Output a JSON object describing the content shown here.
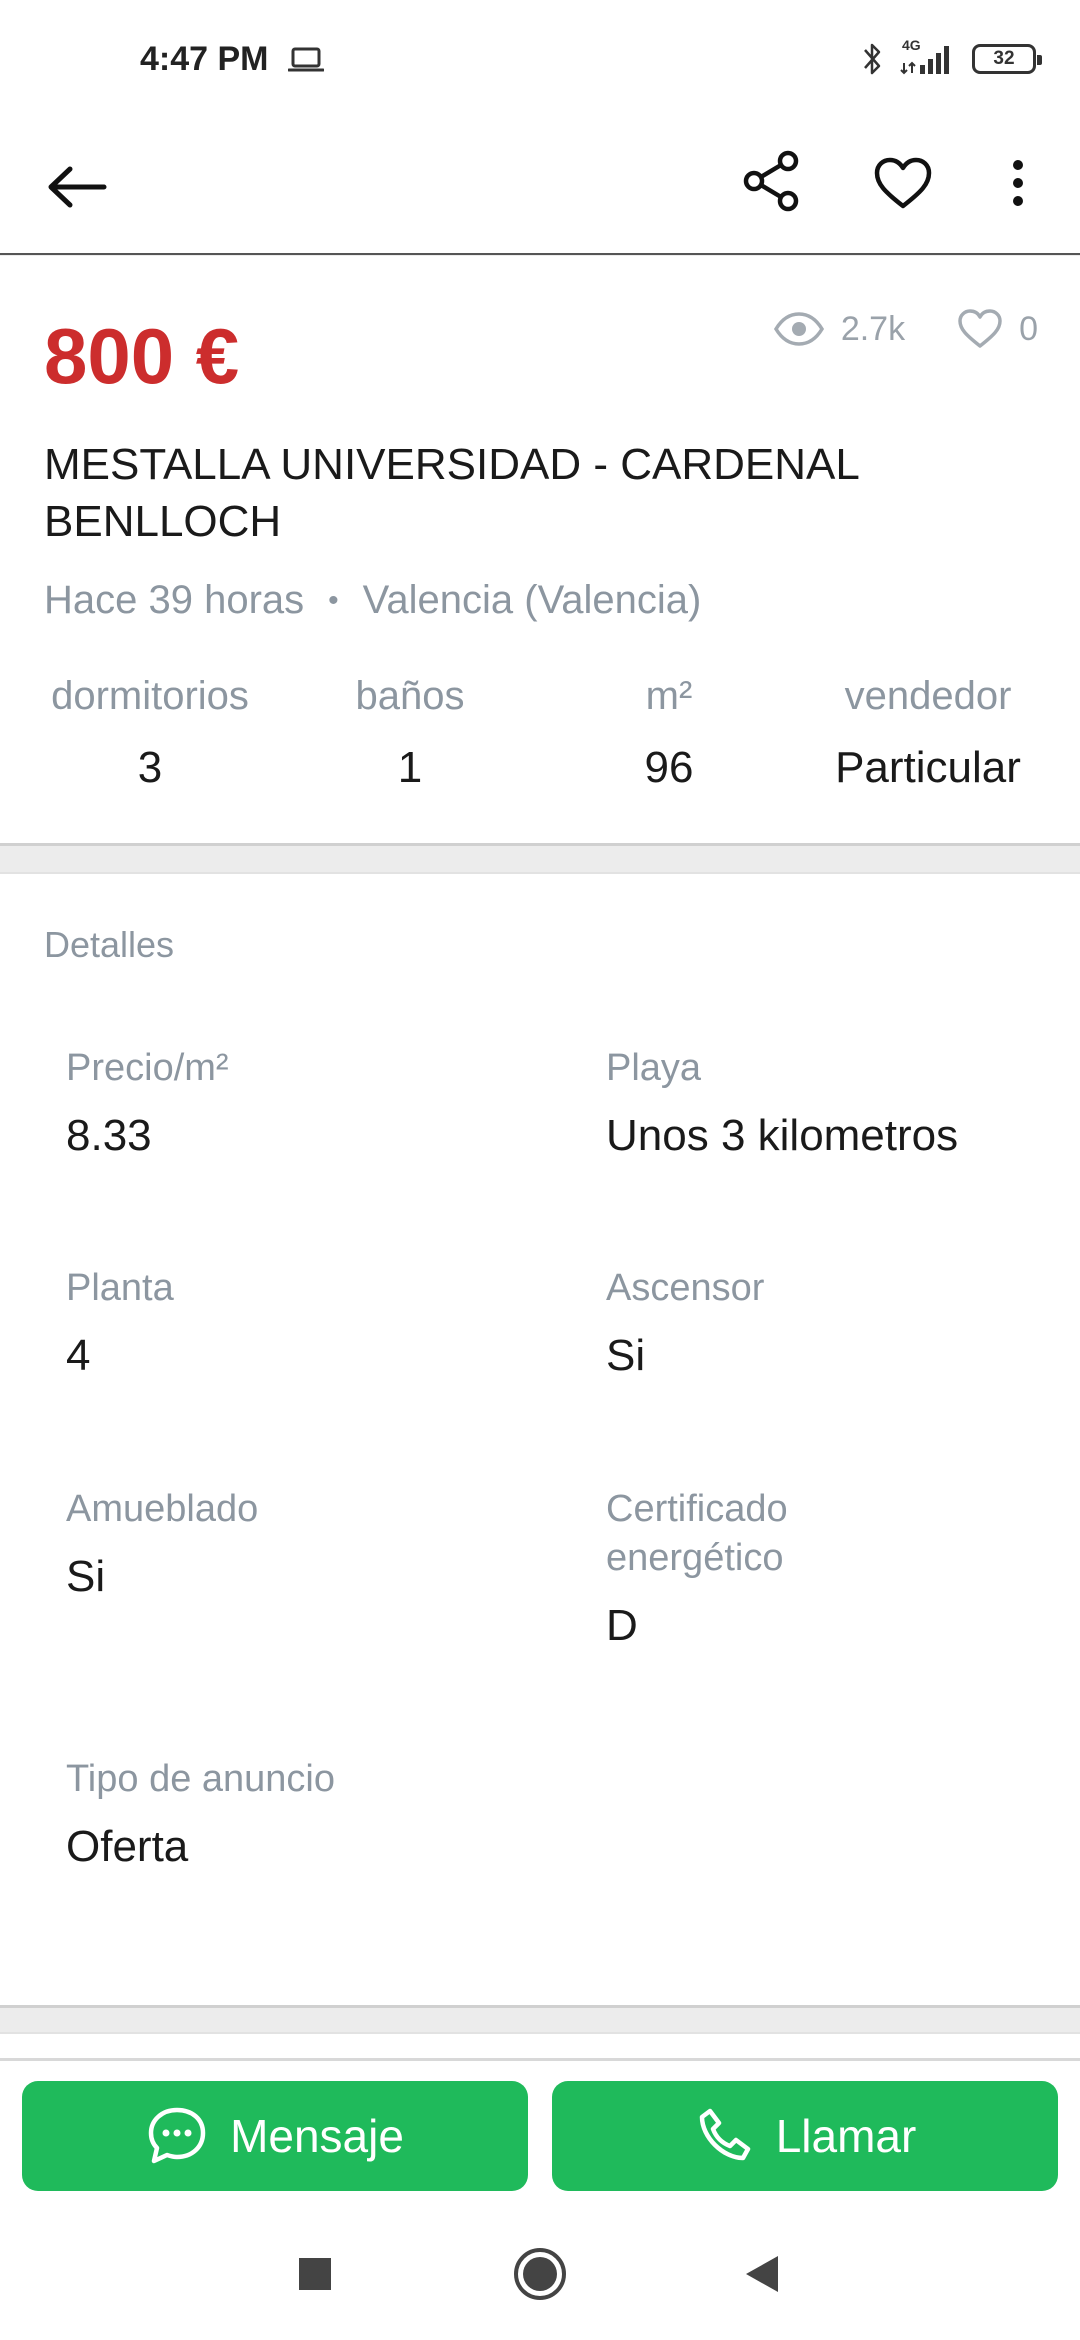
{
  "status_bar": {
    "time": "4:47 PM",
    "network": "4G",
    "battery": "32"
  },
  "app_bar": {
    "back_icon": "arrow-left-icon",
    "share_icon": "share-icon",
    "favorite_icon": "heart-outline-icon",
    "more_icon": "more-vertical-icon"
  },
  "listing": {
    "price": "800 €",
    "views": "2.7k",
    "likes": "0",
    "title": "MESTALLA UNIVERSIDAD - CARDENAL BENLLOCH",
    "posted": "Hace 39 horas",
    "separator": "•",
    "location": "Valencia (Valencia)",
    "features": [
      {
        "label": "dormitorios",
        "value": "3"
      },
      {
        "label": "baños",
        "value": "1"
      },
      {
        "label": "m²",
        "value": "96"
      },
      {
        "label": "vendedor",
        "value": "Particular"
      }
    ]
  },
  "details": {
    "heading": "Detalles",
    "items": [
      {
        "label": "Precio/m²",
        "value": "8.33"
      },
      {
        "label": "Playa",
        "value": "Unos 3 kilometros"
      },
      {
        "label": "Planta",
        "value": "4"
      },
      {
        "label": "Ascensor",
        "value": "Si"
      },
      {
        "label": "Amueblado",
        "value": "Si"
      },
      {
        "label": "Certificado energético",
        "value": "D"
      },
      {
        "label": "Tipo de anuncio",
        "value": "Oferta"
      }
    ]
  },
  "actions": {
    "message_label": "Mensaje",
    "call_label": "Llamar"
  },
  "colors": {
    "price": "#cc2d2d",
    "button": "#1fba5b",
    "muted": "#8c96a0"
  }
}
